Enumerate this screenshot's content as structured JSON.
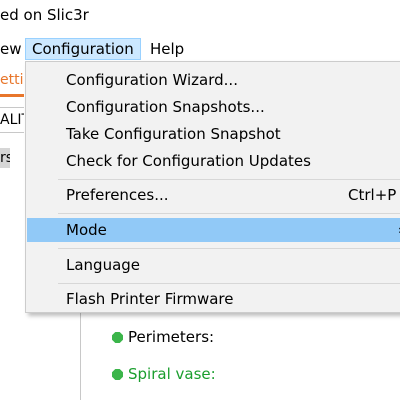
{
  "window": {
    "title": "ed on Slic3r"
  },
  "menubar": {
    "items": [
      {
        "label": "ew"
      },
      {
        "label": "Configuration"
      },
      {
        "label": "Help"
      }
    ]
  },
  "background": {
    "tab_label": "ettin",
    "field_value": "ALIT",
    "selected_item": "rs",
    "rows": [
      {
        "label": "Perimeters:"
      },
      {
        "label": "Spiral vase:"
      }
    ]
  },
  "dropdown": {
    "items": [
      {
        "label": "Configuration Wizard..."
      },
      {
        "label": "Configuration Snapshots..."
      },
      {
        "label": "Take Configuration Snapshot"
      },
      {
        "label": "Check for Configuration Updates"
      },
      {
        "label": "Preferences...",
        "shortcut": "Ctrl+P"
      },
      {
        "label": "Mode",
        "submenu_arrow": "›"
      },
      {
        "label": "Language"
      },
      {
        "label": "Flash Printer Firmware"
      }
    ]
  },
  "colors": {
    "accent": "#e8762b",
    "highlight": "#91c9f7",
    "status_green": "#3bb54a"
  }
}
